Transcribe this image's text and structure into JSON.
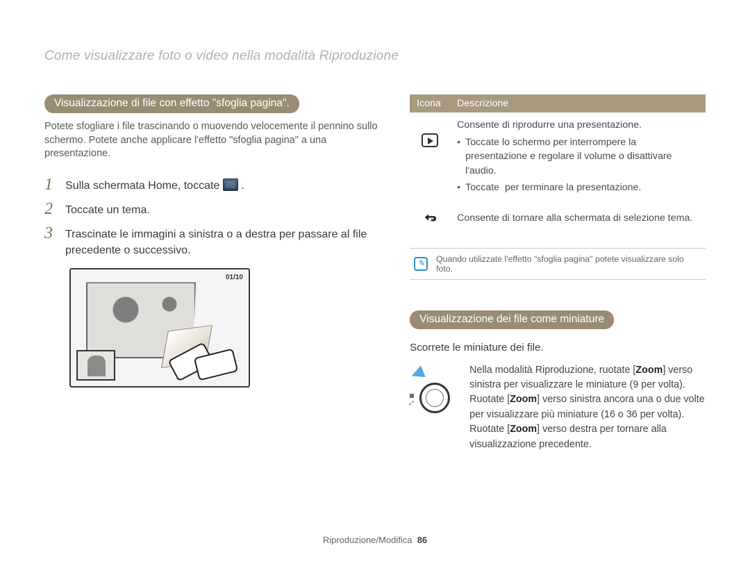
{
  "page_title": "Come visualizzare foto o video nella modalità Riproduzione",
  "left": {
    "section_heading": "Visualizzazione di file con effetto \"sfoglia pagina\".",
    "intro": "Potete sfogliare i file trascinando o muovendo velocemente il pennino sullo schermo. Potete anche applicare l'effetto \"sfoglia pagina\" a una presentazione.",
    "steps": [
      {
        "n": "1",
        "before": "Sulla schermata Home, toccate ",
        "after": "."
      },
      {
        "n": "2",
        "text": "Toccate un tema."
      },
      {
        "n": "3",
        "text": "Trascinate le immagini a sinistra o a destra per passare al file precedente o successivo."
      }
    ],
    "illus_counter": "01/10"
  },
  "right": {
    "table": {
      "head_icon": "Icona",
      "head_desc": "Descrizione",
      "row1_title": "Consente di riprodurre una presentazione.",
      "row1_b1": "Toccate lo schermo per interrompere la presentazione e regolare il volume o disattivare l'audio.",
      "row1_b2_before": "Toccate ",
      "row1_b2_after": " per terminare la presentazione.",
      "row2": "Consente di tornare alla schermata di selezione tema."
    },
    "note": "Quando utilizzate l'effetto \"sfoglia pagina\" potete visualizzare solo foto.",
    "sec2_heading": "Visualizzazione dei file come miniature",
    "sec2_intro": "Scorrete le miniature dei file.",
    "zoom_p1_a": "Nella modalità Riproduzione, ruotate [",
    "zoom_p1_b": "Zoom",
    "zoom_p1_c": "] verso sinistra per visualizzare le miniature (9 per volta). Ruotate [",
    "zoom_p1_d": "Zoom",
    "zoom_p1_e": "] verso sinistra ancora una o due volte per visualizzare più miniature (16 o 36 per volta). Ruotate [",
    "zoom_p1_f": "Zoom",
    "zoom_p1_g": "] verso destra per tornare alla visualizzazione precedente."
  },
  "footer": {
    "section": "Riproduzione/Modifica",
    "page": "86"
  }
}
